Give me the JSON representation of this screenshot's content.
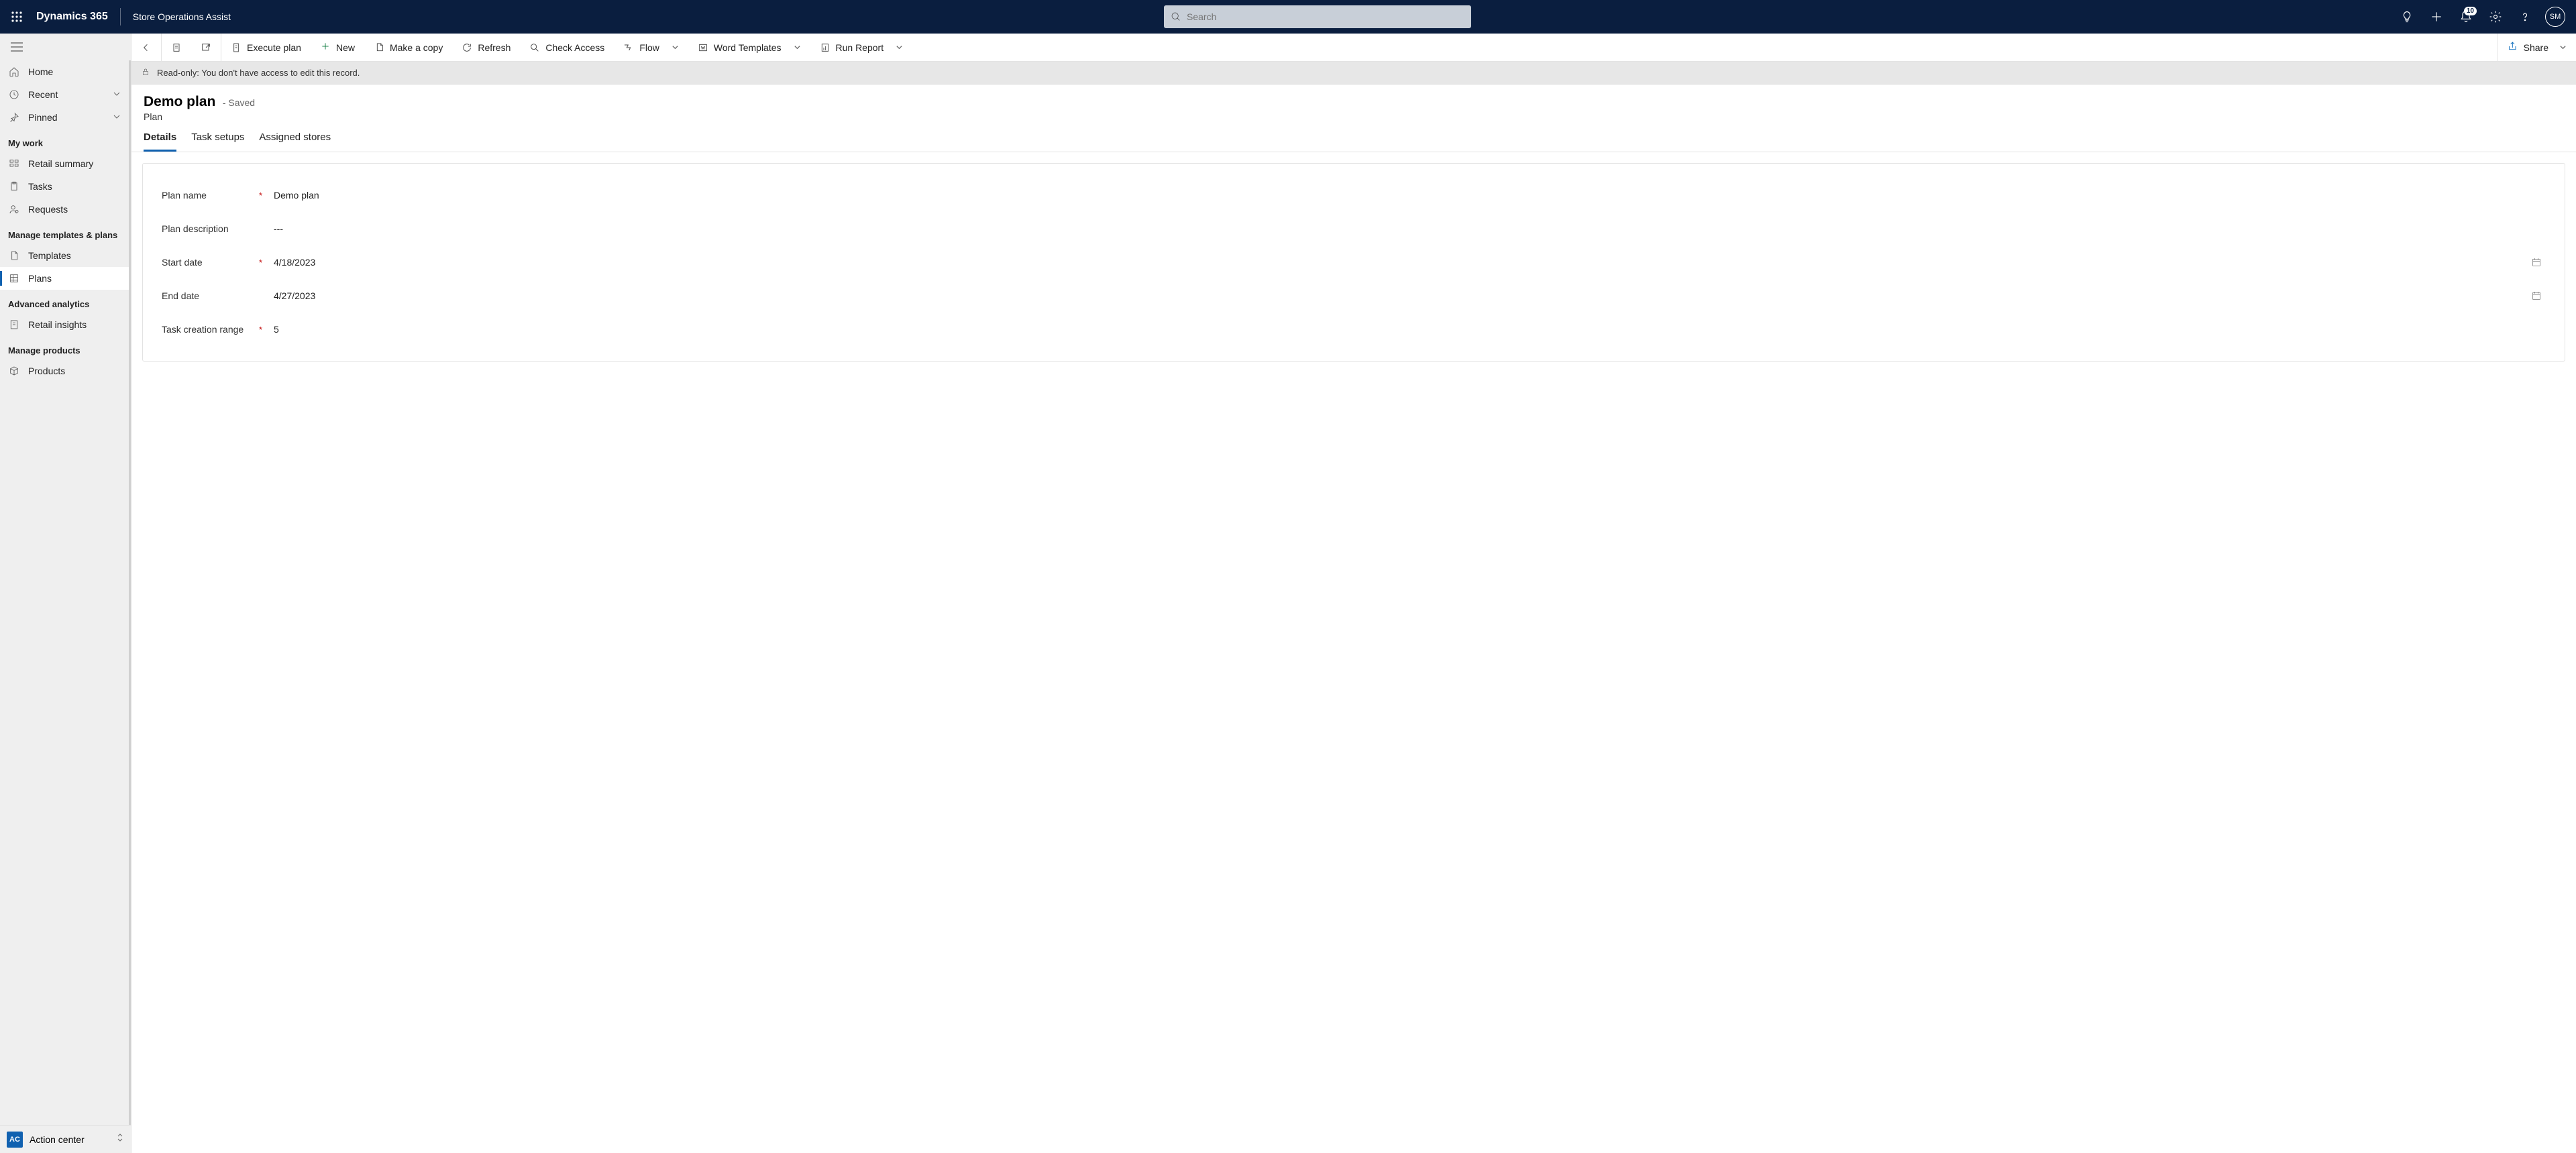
{
  "header": {
    "brand": "Dynamics 365",
    "app_name": "Store Operations Assist",
    "search_placeholder": "Search",
    "notification_count": "10",
    "user_initials": "SM"
  },
  "sidebar": {
    "items": [
      {
        "label": "Home"
      },
      {
        "label": "Recent"
      },
      {
        "label": "Pinned"
      }
    ],
    "groups": [
      {
        "title": "My work",
        "items": [
          {
            "label": "Retail summary"
          },
          {
            "label": "Tasks"
          },
          {
            "label": "Requests"
          }
        ]
      },
      {
        "title": "Manage templates & plans",
        "items": [
          {
            "label": "Templates"
          },
          {
            "label": "Plans"
          }
        ]
      },
      {
        "title": "Advanced analytics",
        "items": [
          {
            "label": "Retail insights"
          }
        ]
      },
      {
        "title": "Manage products",
        "items": [
          {
            "label": "Products"
          }
        ]
      }
    ],
    "bottom": {
      "badge": "AC",
      "label": "Action center"
    }
  },
  "commands": {
    "execute_plan": "Execute plan",
    "new": "New",
    "make_copy": "Make a copy",
    "refresh": "Refresh",
    "check_access": "Check Access",
    "flow": "Flow",
    "word_templates": "Word Templates",
    "run_report": "Run Report",
    "share": "Share"
  },
  "readonly_msg": "Read-only: You don't have access to edit this record.",
  "record": {
    "name": "Demo plan",
    "status": "- Saved",
    "entity": "Plan"
  },
  "tabs": {
    "details": "Details",
    "task_setups": "Task setups",
    "assigned_stores": "Assigned stores"
  },
  "form": {
    "plan_name_label": "Plan name",
    "plan_name_value": "Demo plan",
    "plan_desc_label": "Plan description",
    "plan_desc_value": "---",
    "start_date_label": "Start date",
    "start_date_value": "4/18/2023",
    "end_date_label": "End date",
    "end_date_value": "4/27/2023",
    "task_range_label": "Task creation range",
    "task_range_value": "5"
  }
}
